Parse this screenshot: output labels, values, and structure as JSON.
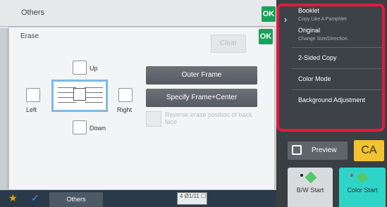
{
  "base": {
    "title": "Others",
    "ok_label": "OK"
  },
  "erase": {
    "title": "Erase",
    "ok_label": "OK",
    "clear_label": "Clear",
    "up_label": "Up",
    "left_label": "Left",
    "right_label": "Right",
    "down_label": "Down",
    "outer_frame_label": "Outer Frame",
    "frame_center_label": "Specify Frame+Center",
    "reverse_label": "Reverse erase position of back face"
  },
  "menu": {
    "items": [
      {
        "label": "Booklet",
        "sub": "Copy Like A Pamphlet"
      },
      {
        "label": "Original",
        "sub": "Change Size/Direction."
      },
      {
        "label": "2-Sided Copy"
      },
      {
        "label": "Color Mode"
      },
      {
        "label": "Background Adjustment"
      }
    ]
  },
  "actions": {
    "preview_label": "Preview",
    "ca_label": "CA",
    "bw_start_label": "B/W Start",
    "color_start_label": "Color Start"
  },
  "bottom": {
    "others_tab_label": "Others",
    "counter_text": "4 Ø1/11 ☐"
  },
  "icons": {
    "star": "star-icon",
    "check": "check-icon",
    "chevron": "chevron-right-icon",
    "preview": "preview-icon",
    "start": "diamond-icon"
  },
  "colors": {
    "ok": "#1aa15a",
    "highlight_border": "#e3193e",
    "ca": "#f2c230",
    "color_start": "#2fd4c8",
    "book_border": "#7fb9e3"
  }
}
